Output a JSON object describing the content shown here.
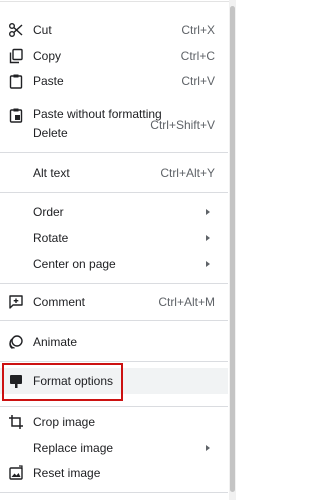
{
  "menu": {
    "items": [
      {
        "label": "Cut",
        "shortcut": "Ctrl+X",
        "icon": "scissors-icon"
      },
      {
        "label": "Copy",
        "shortcut": "Ctrl+C",
        "icon": "copy-icon"
      },
      {
        "label": "Paste",
        "shortcut": "Ctrl+V",
        "icon": "paste-icon"
      },
      {
        "label": "Paste without formatting",
        "shortcut": "Ctrl+Shift+V",
        "icon": "paste-plain-icon"
      },
      {
        "label": "Delete"
      },
      {
        "label": "Alt text",
        "shortcut": "Ctrl+Alt+Y"
      },
      {
        "label": "Order",
        "submenu": true
      },
      {
        "label": "Rotate",
        "submenu": true
      },
      {
        "label": "Center on page",
        "submenu": true
      },
      {
        "label": "Comment",
        "shortcut": "Ctrl+Alt+M",
        "icon": "comment-icon"
      },
      {
        "label": "Animate",
        "icon": "animate-icon"
      },
      {
        "label": "Format options",
        "icon": "format-options-icon",
        "highlighted": true
      },
      {
        "label": "Crop image",
        "icon": "crop-icon"
      },
      {
        "label": "Replace image",
        "submenu": true
      },
      {
        "label": "Reset image",
        "icon": "reset-image-icon"
      }
    ]
  },
  "colors": {
    "highlight_box": "#cc1111",
    "hover_background": "#f1f3f4",
    "text": "#202124",
    "shortcut_text": "#5f6368"
  }
}
